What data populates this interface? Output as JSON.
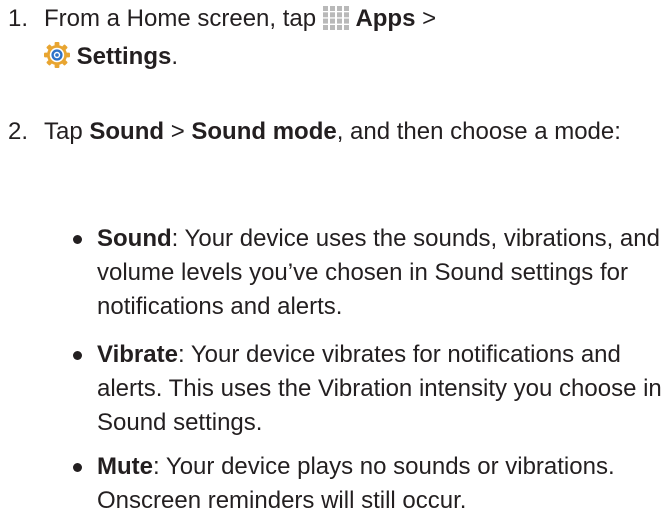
{
  "step1": {
    "number": "1.",
    "text_before": "From a Home screen, tap ",
    "apps_label": "Apps",
    "separator": " >",
    "settings_label": "Settings",
    "end": ".",
    "apps_icon": "apps-grid-icon",
    "settings_icon": "settings-gear-icon"
  },
  "step2": {
    "number": "2.",
    "tap": "Tap ",
    "sound_label": "Sound",
    "separator": " > ",
    "sound_mode_label": "Sound mode",
    "text_after": ", and then choose a mode:"
  },
  "modes": [
    {
      "name": "Sound",
      "description": ": Your device uses the sounds, vibrations, and volume levels you’ve chosen in Sound settings for notifications and alerts."
    },
    {
      "name": "Vibrate",
      "description": ": Your device vibrates for notifications and alerts. This uses the Vibration intensity you choose in Sound settings."
    },
    {
      "name": "Mute",
      "description": ": Your device plays no sounds or vibrations. Onscreen reminders will still occur."
    }
  ],
  "colors": {
    "text": "#231f20",
    "apps_icon": "#b9b9b9",
    "settings_icon_outer": "#e8a531",
    "settings_icon_inner": "#2e72c8"
  }
}
